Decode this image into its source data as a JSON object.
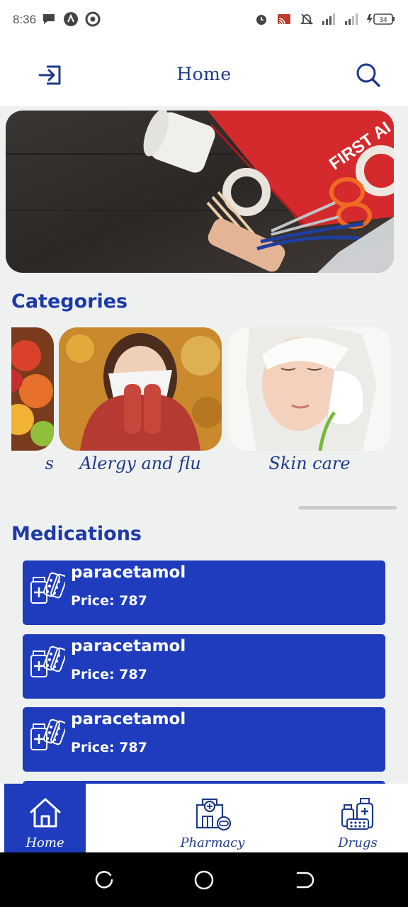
{
  "status_bar": {
    "time": "8:36",
    "battery": "34"
  },
  "app_bar": {
    "title": "Home",
    "left_icon": "logout-icon",
    "right_icon": "search-icon"
  },
  "banner": {
    "text": "FIRST AI"
  },
  "categories": {
    "title": "Categories",
    "items": [
      {
        "label": "s"
      },
      {
        "label": "Alergy and flu"
      },
      {
        "label": "Skin care"
      }
    ]
  },
  "medications": {
    "title": "Medications",
    "items": [
      {
        "name": "paracetamol",
        "price": "Price: 787"
      },
      {
        "name": "paracetamol",
        "price": "Price: 787"
      },
      {
        "name": "paracetamol",
        "price": "Price: 787"
      }
    ]
  },
  "bottom_nav": {
    "items": [
      {
        "label": "Home",
        "icon": "home-icon",
        "active": true
      },
      {
        "label": "Pharmacy",
        "icon": "pharmacy-icon",
        "active": false
      },
      {
        "label": "Drugs",
        "icon": "drugs-icon",
        "active": false
      }
    ]
  },
  "colors": {
    "primary": "#1e3cbd",
    "title": "#1e3a8a",
    "background": "#eff1f0"
  }
}
